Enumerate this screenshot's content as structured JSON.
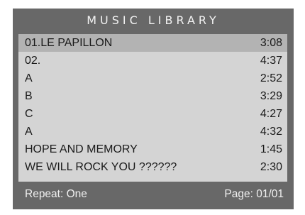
{
  "header": {
    "title": "MUSIC  LIBRARY"
  },
  "tracks": [
    {
      "name": "01.LE PAPILLON",
      "duration": "3:08",
      "selected": true
    },
    {
      "name": "02.",
      "duration": "4:37",
      "selected": false
    },
    {
      "name": "A",
      "duration": "2:52",
      "selected": false
    },
    {
      "name": "B",
      "duration": "3:29",
      "selected": false
    },
    {
      "name": "C",
      "duration": "4:27",
      "selected": false
    },
    {
      "name": "A",
      "duration": "4:32",
      "selected": false
    },
    {
      "name": "HOPE AND MEMORY",
      "duration": "1:45",
      "selected": false
    },
    {
      "name": "WE WILL ROCK YOU ??????",
      "duration": "2:30",
      "selected": false
    }
  ],
  "footer": {
    "repeat": "Repeat: One",
    "page": "Page: 01/01"
  },
  "colors": {
    "frame": "#686868",
    "list_bg": "#d4d4d4",
    "selected_row": "#b3b3b3",
    "text": "#1a1a1a",
    "light_text": "#f0f0f0"
  }
}
